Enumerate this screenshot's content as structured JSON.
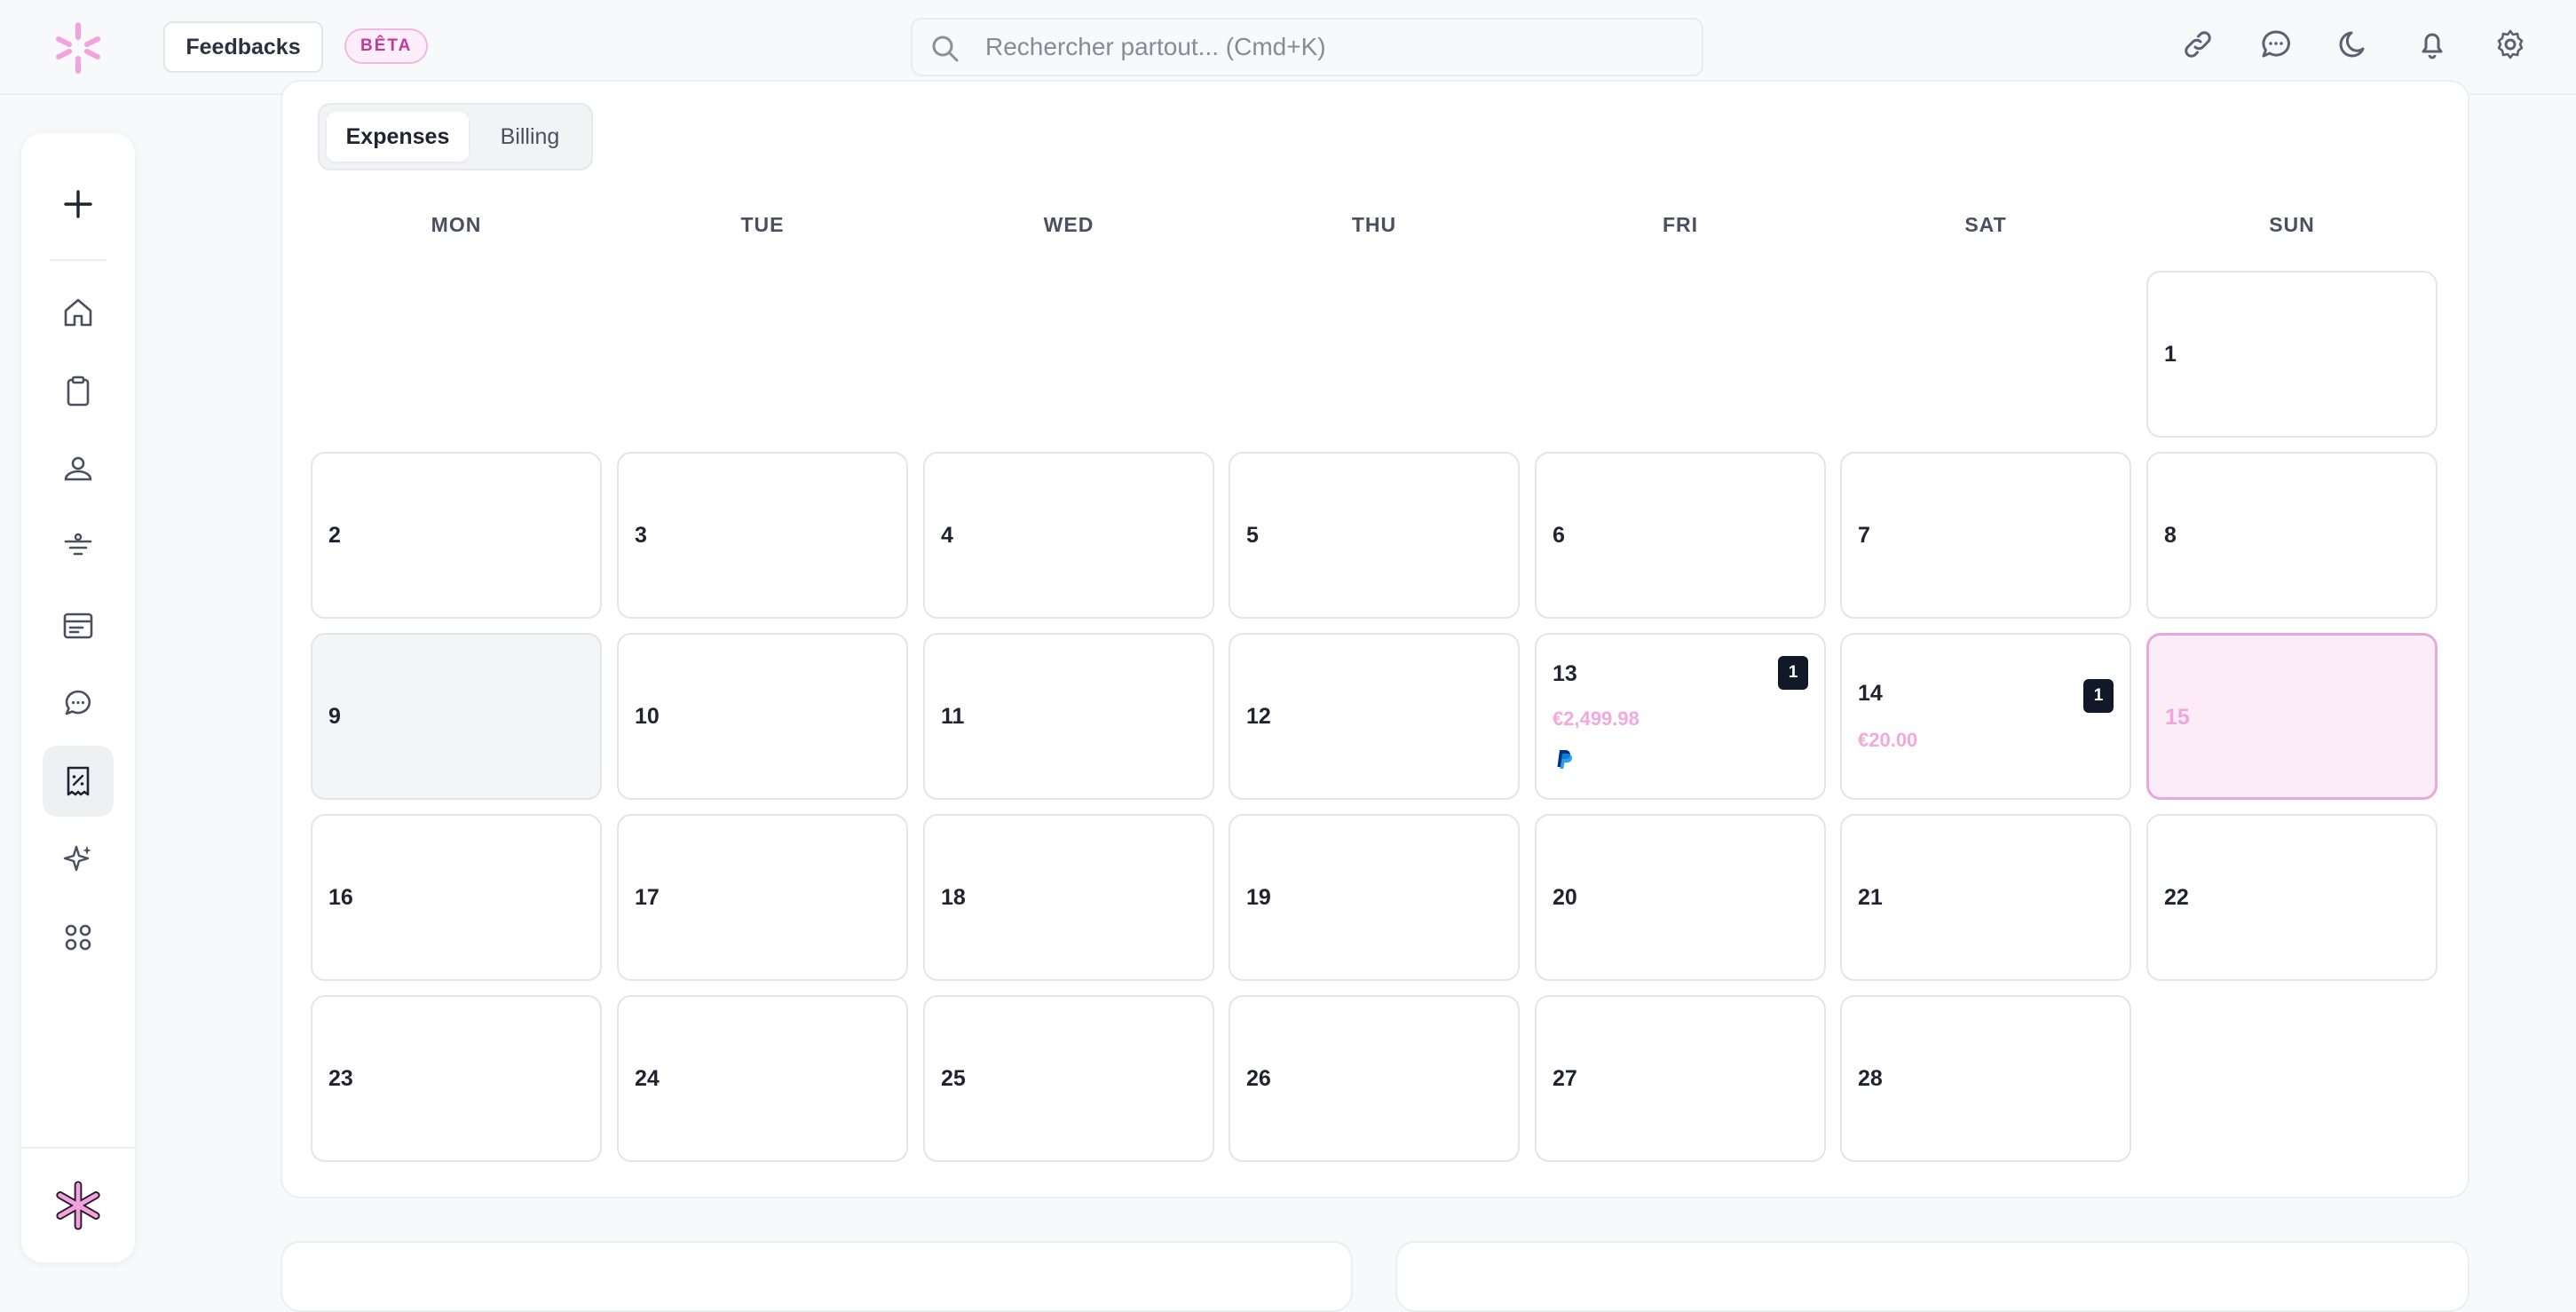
{
  "header": {
    "feedbacks_label": "Feedbacks",
    "beta_label": "BÊTA",
    "search_placeholder": "Rechercher partout... (Cmd+K)",
    "icons": [
      "link-icon",
      "chat-icon",
      "moon-icon",
      "bell-icon",
      "gear-icon"
    ]
  },
  "sidebar": {
    "items": [
      {
        "name": "add",
        "icon": "plus-icon"
      },
      {
        "name": "home",
        "icon": "home-icon"
      },
      {
        "name": "clipboard",
        "icon": "clipboard-icon"
      },
      {
        "name": "team",
        "icon": "users-icon"
      },
      {
        "name": "filters",
        "icon": "filter-icon"
      },
      {
        "name": "inbox",
        "icon": "archive-icon"
      },
      {
        "name": "messages",
        "icon": "chat-icon"
      },
      {
        "name": "expenses",
        "icon": "receipt-icon",
        "active": true
      },
      {
        "name": "ai",
        "icon": "sparkle-icon"
      },
      {
        "name": "apps",
        "icon": "grid-icon"
      }
    ]
  },
  "tabs": {
    "expenses": "Expenses",
    "billing": "Billing",
    "active": "Expenses"
  },
  "calendar": {
    "weekdays": [
      "MON",
      "TUE",
      "WED",
      "THU",
      "FRI",
      "SAT",
      "SUN"
    ],
    "days": {
      "d1": "1",
      "d2": "2",
      "d3": "3",
      "d4": "4",
      "d5": "5",
      "d6": "6",
      "d7": "7",
      "d8": "8",
      "d9": "9",
      "d10": "10",
      "d11": "11",
      "d12": "12",
      "d13": "13",
      "d14": "14",
      "d15": "15",
      "d16": "16",
      "d17": "17",
      "d18": "18",
      "d19": "19",
      "d20": "20",
      "d21": "21",
      "d22": "22",
      "d23": "23",
      "d24": "24",
      "d25": "25",
      "d26": "26",
      "d27": "27",
      "d28": "28"
    },
    "today": "15",
    "events": {
      "d13": {
        "count": "1",
        "amount": "€2,499.98",
        "icon": "paypal-icon"
      },
      "d14": {
        "count": "1",
        "amount": "€20.00"
      }
    },
    "colors": {
      "accent": "#f3a8de",
      "today_bg": "#fcecf8",
      "badge": "#111827"
    }
  }
}
